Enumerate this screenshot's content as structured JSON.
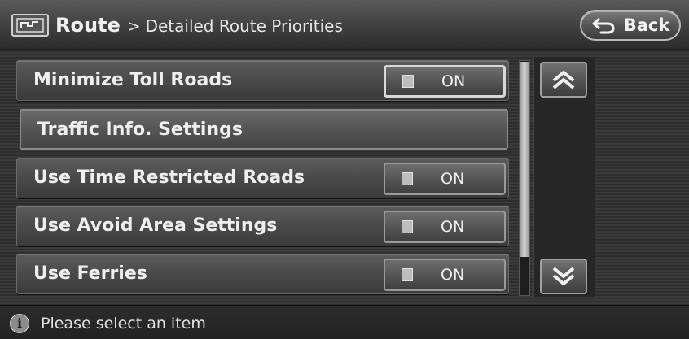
{
  "header": {
    "icon": "route-map-icon",
    "title_main": "Route",
    "title_separator": ">",
    "title_sub": "Detailed Route Priorities",
    "back_label": "Back"
  },
  "list": {
    "rows": [
      {
        "label": "Minimize Toll Roads",
        "toggle": "ON",
        "selected": true
      },
      {
        "label": "Traffic Info. Settings"
      },
      {
        "label": "Use Time Restricted Roads",
        "toggle": "ON"
      },
      {
        "label": "Use Avoid Area Settings",
        "toggle": "ON"
      },
      {
        "label": "Use Ferries",
        "toggle": "ON"
      }
    ]
  },
  "scroll": {
    "up_icon": "chevron-double-up-icon",
    "down_icon": "chevron-double-down-icon"
  },
  "footer": {
    "icon": "info-icon",
    "info_glyph": "i",
    "message": "Please select an item"
  }
}
